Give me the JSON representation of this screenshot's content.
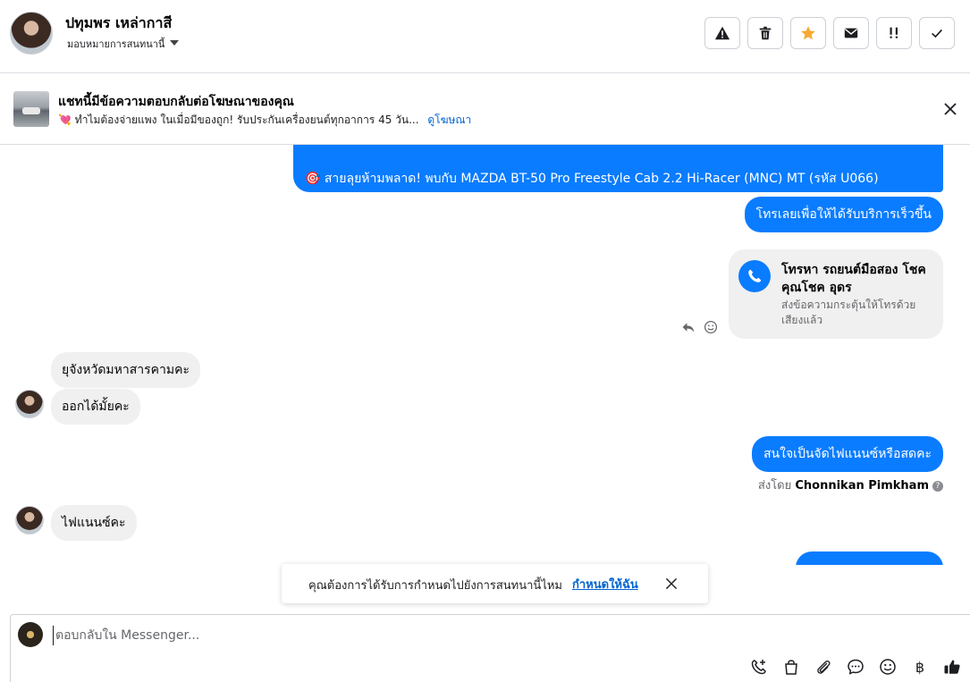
{
  "header": {
    "contact_name": "ปทุมพร เหล่ากาสี",
    "assign_label": "มอบหมายการสนทนานี้",
    "tools": [
      {
        "name": "spam-icon"
      },
      {
        "name": "trash-icon"
      },
      {
        "name": "star-icon",
        "color": "#f7a933"
      },
      {
        "name": "mail-icon"
      },
      {
        "name": "priority-icon"
      },
      {
        "name": "check-icon"
      }
    ]
  },
  "ad_banner": {
    "title": "แชทนี้มีข้อความตอบกลับต่อโฆษณาของคุณ",
    "subtitle": "ทำไมต้องจ่ายแพง ในเมื่อมีของถูก! รับประกันเครื่องยนต์ทุกอาการ 45 วัน...",
    "link": "ดูโฆษณา"
  },
  "messages": {
    "out_promo": "🎯 สายลุยห้ามพลาด! พบกับ MAZDA BT-50 Pro Freestyle Cab 2.2 Hi-Racer (MNC) MT (รหัส U066)",
    "out_call_prompt": "โทรเลยเพื่อให้ได้รับบริการเร็วขึ้น",
    "call_card_title": "โทรหา รถยนต์มือสอง โชคคุณโชค อุดร",
    "call_card_sub": "ส่งข้อความกระตุ้นให้โทรด้วยเสียงแล้ว",
    "in_1": "ยุจังหวัดมหาสารคามคะ",
    "in_2": "ออกได้มั้ยคะ",
    "out_2": "สนใจเป็นจัดไฟแนนซ์หรือสดคะ",
    "sent_by_prefix": "ส่งโดย",
    "sent_by_name": "Chonnikan Pimkham",
    "in_3": "ไฟแนนซ์คะ"
  },
  "toast": {
    "text": "คุณต้องการได้รับการกำหนดไปยังการสนทนานี้ไหม",
    "link": "กำหนดให้ฉัน"
  },
  "composer": {
    "placeholder": "ตอบกลับใน Messenger...",
    "currency_symbol": "฿"
  },
  "colors": {
    "brand_blue": "#0a7cff",
    "link_blue": "#0064d1"
  }
}
